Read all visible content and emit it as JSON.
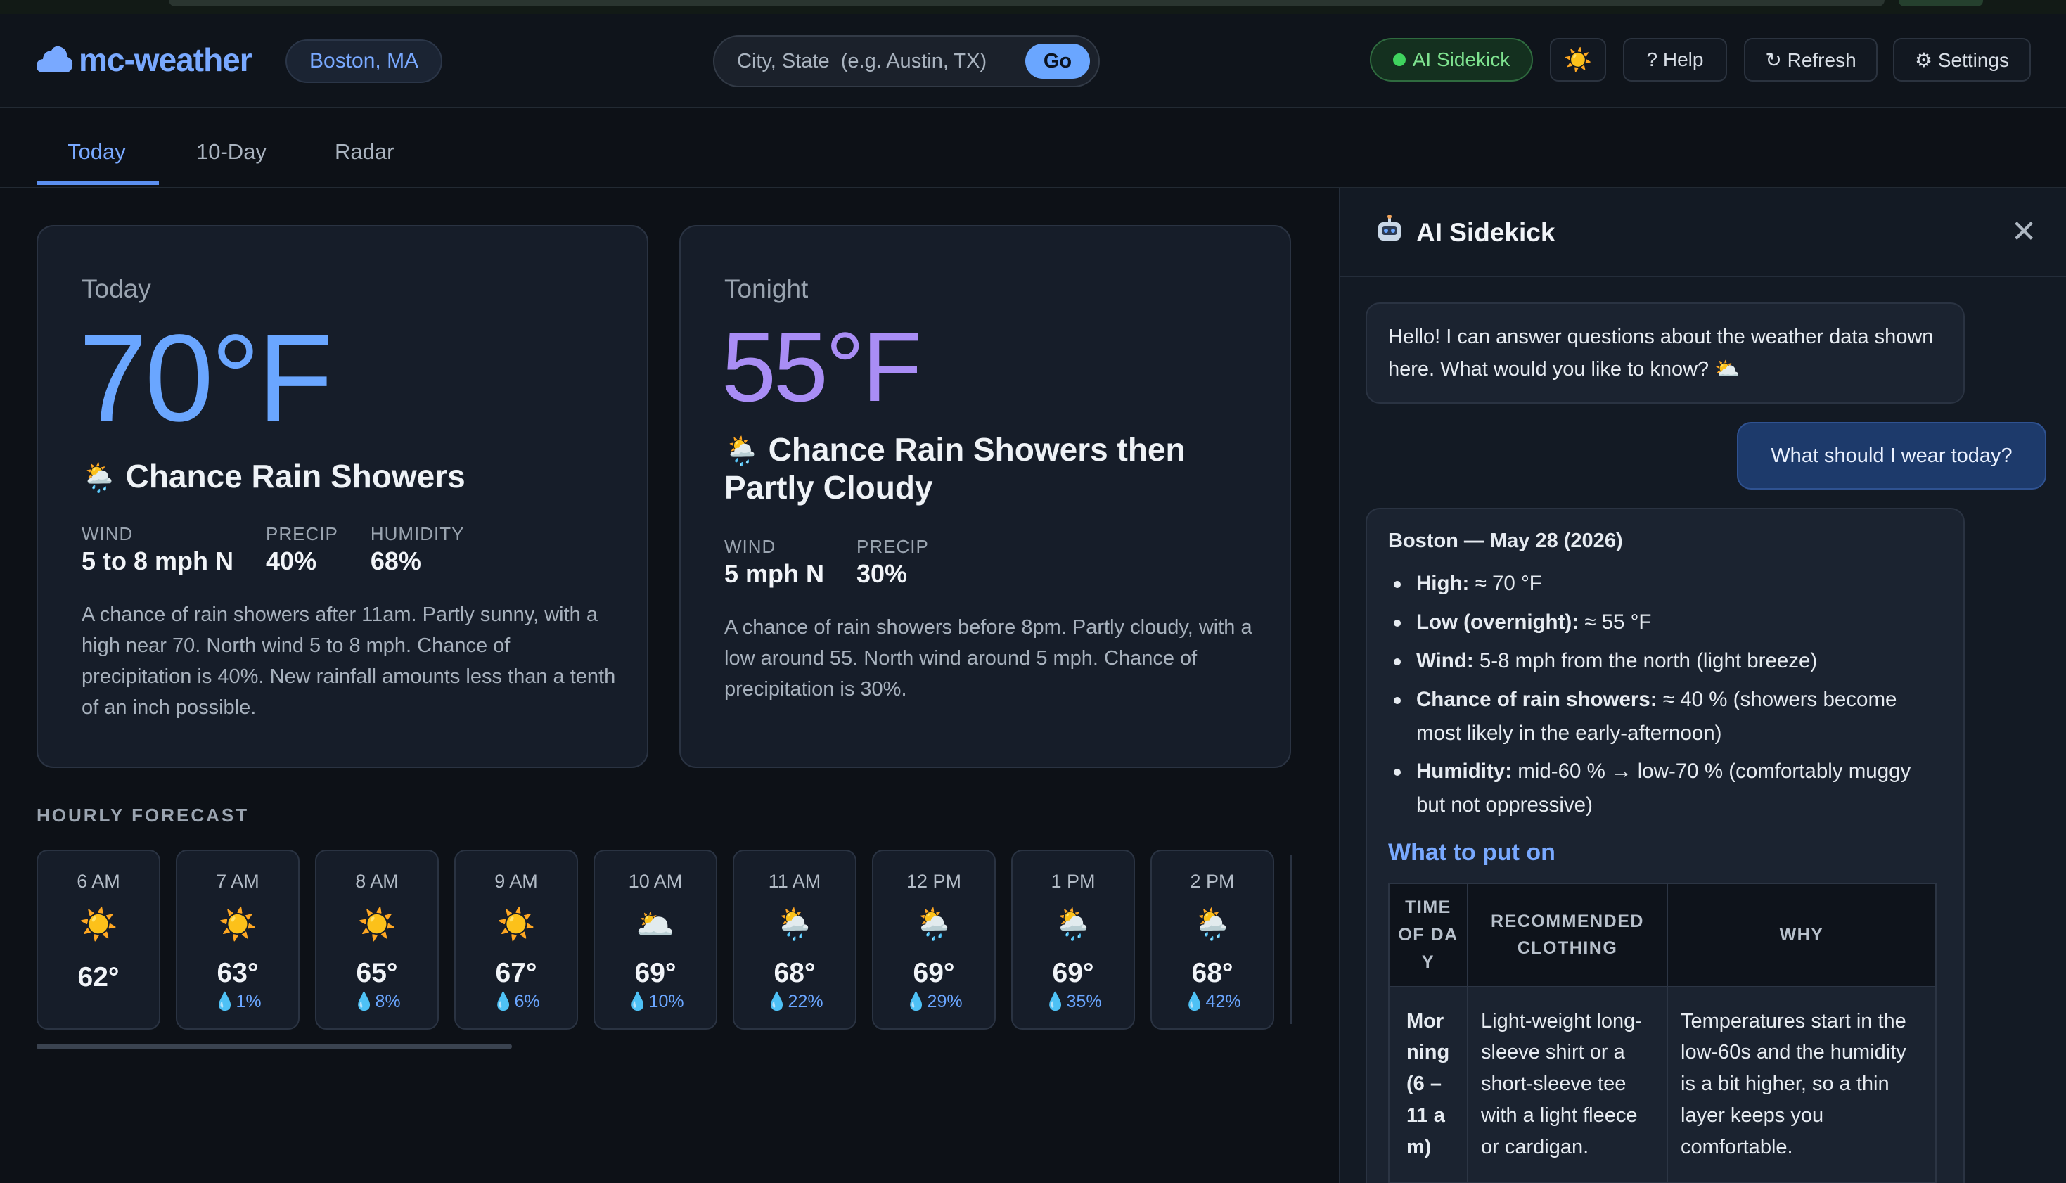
{
  "app": {
    "name": "mc-weather",
    "location": "Boston, MA",
    "search_placeholder": "City, State  (e.g. Austin, TX)",
    "go_label": "Go"
  },
  "header": {
    "ai_label": "AI Sidekick",
    "theme_icon": "☀️",
    "help_label": "? Help",
    "refresh_label": "↻ Refresh",
    "settings_label": "⚙ Settings"
  },
  "tabs": [
    {
      "label": "Today",
      "active": true
    },
    {
      "label": "10-Day",
      "active": false
    },
    {
      "label": "Radar",
      "active": false
    }
  ],
  "today": {
    "label": "Today",
    "temp": "70°F",
    "icon": "🌦️",
    "condition": "Chance Rain Showers",
    "stats": [
      {
        "label": "WIND",
        "value": "5 to 8 mph N"
      },
      {
        "label": "PRECIP",
        "value": "40%"
      },
      {
        "label": "HUMIDITY",
        "value": "68%"
      }
    ],
    "description": "A chance of rain showers after 11am. Partly sunny, with a high near 70. North wind 5 to 8 mph. Chance of precipitation is 40%. New rainfall amounts less than a tenth of an inch possible."
  },
  "tonight": {
    "label": "Tonight",
    "temp": "55°F",
    "icon": "🌦️",
    "condition_line1": "Chance Rain Showers then",
    "condition_line2": "Partly Cloudy",
    "stats": [
      {
        "label": "WIND",
        "value": "5 mph N"
      },
      {
        "label": "PRECIP",
        "value": "30%"
      }
    ],
    "description": "A chance of rain showers before 8pm. Partly cloudy, with a low around 55. North wind around 5 mph. Chance of precipitation is 30%."
  },
  "hourly": {
    "title": "HOURLY FORECAST",
    "items": [
      {
        "time": "6 AM",
        "icon": "☀️",
        "temp": "62°",
        "precip": ""
      },
      {
        "time": "7 AM",
        "icon": "☀️",
        "temp": "63°",
        "precip": "💧1%"
      },
      {
        "time": "8 AM",
        "icon": "☀️",
        "temp": "65°",
        "precip": "💧8%"
      },
      {
        "time": "9 AM",
        "icon": "☀️",
        "temp": "67°",
        "precip": "💧6%"
      },
      {
        "time": "10 AM",
        "icon": "🌥️",
        "temp": "69°",
        "precip": "💧10%"
      },
      {
        "time": "11 AM",
        "icon": "🌦️",
        "temp": "68°",
        "precip": "💧22%"
      },
      {
        "time": "12 PM",
        "icon": "🌦️",
        "temp": "69°",
        "precip": "💧29%"
      },
      {
        "time": "1 PM",
        "icon": "🌦️",
        "temp": "69°",
        "precip": "💧35%"
      },
      {
        "time": "2 PM",
        "icon": "🌦️",
        "temp": "68°",
        "precip": "💧42%"
      }
    ]
  },
  "sidekick": {
    "title": "AI Sidekick",
    "greeting": "Hello! I can answer questions about the weather data shown here. What would you like to know? ⛅",
    "user_message": "What should I wear today?",
    "reply": {
      "heading": "Boston — May 28 (2026)",
      "bullets": [
        {
          "label": "High:",
          "text": " ≈ 70 °F"
        },
        {
          "label": "Low (overnight):",
          "text": " ≈ 55 °F"
        },
        {
          "label": "Wind:",
          "text": " 5-8 mph from the north (light breeze)"
        },
        {
          "label": "Chance of rain showers:",
          "text": " ≈ 40 % (showers become most likely in the early-afternoon)"
        },
        {
          "label": "Humidity:",
          "text": " mid-60 % → low-70 % (comfortably muggy but not oppressive)"
        }
      ],
      "wear_title": "What to put on",
      "table_headers": [
        "TIME OF DAY",
        "RECOMMENDED CLOTHING",
        "WHY"
      ],
      "table_rows": [
        {
          "time": "Morning (6 – 11 am)",
          "clothing": "Light-weight long-sleeve shirt or a short-sleeve tee with a light fleece or cardigan.",
          "why": "Temperatures start in the low-60s and the humidity is a bit higher, so a thin layer keeps you comfortable."
        }
      ]
    }
  },
  "colors": {
    "accent": "#6aa6ff",
    "tonight_accent": "#a98df5",
    "ai_green": "#3fd35e"
  }
}
